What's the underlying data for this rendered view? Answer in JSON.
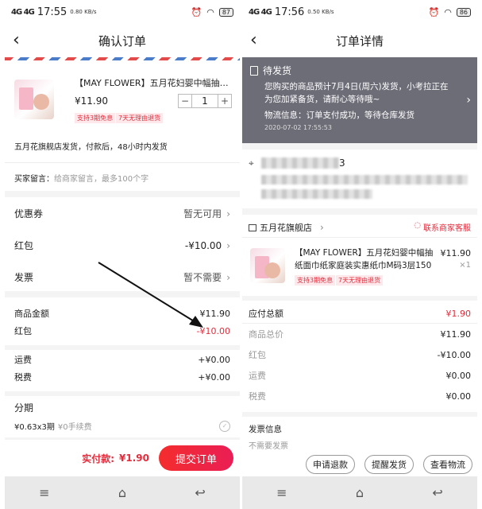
{
  "left": {
    "status": {
      "signal": "4G 4G",
      "time": "17:55",
      "speed": "0.80 KB/s",
      "battery": "87"
    },
    "title": "确认订单",
    "product": {
      "title": "【MAY FLOWER】五月花妇婴中幅抽纸面…",
      "price": "¥11.90",
      "quantity": "1",
      "tag_installment": "支持3期免息",
      "tag_return": "7天无理由退货"
    },
    "shipping_note": "五月花旗舰店发货，付款后，48小时内发货",
    "buyer_message": {
      "label": "买家留言：",
      "placeholder": "给商家留言，最多100个字"
    },
    "options": [
      {
        "label": "优惠券",
        "value": "暂无可用"
      },
      {
        "label": "红包",
        "value": "-¥10.00"
      },
      {
        "label": "发票",
        "value": "暂不需要"
      }
    ],
    "summary": [
      {
        "label": "商品金额",
        "value": "¥11.90"
      },
      {
        "label": "红包",
        "value": "-¥10.00"
      },
      {
        "label": "运费",
        "value": "+¥0.00"
      },
      {
        "label": "税费",
        "value": "+¥0.00"
      }
    ],
    "installment": {
      "title": "分期",
      "plan": "¥0.63x3期",
      "fee": "¥0手续费"
    },
    "total": {
      "label": "实付款:",
      "value": "¥1.90"
    },
    "submit": "提交订单"
  },
  "right": {
    "status": {
      "signal": "4G 4G",
      "time": "17:56",
      "speed": "0.50 KB/s",
      "battery": "86"
    },
    "title": "订单详情",
    "order_status": {
      "title": "待发货",
      "message": "您购买的商品预计7月4日(周六)发货，小考拉正在为您加紧备货，请耐心等待哦~",
      "logistics": "物流信息：订单支付成功，等待仓库发货",
      "time": "2020-07-02 17:55:53"
    },
    "address": {
      "visible": "3"
    },
    "store": {
      "name": "五月花旗舰店",
      "service": "联系商家客服"
    },
    "product": {
      "title": "【MAY FLOWER】五月花妇婴中幅抽纸面巾纸家庭装实惠纸巾M码3层150抽…",
      "price": "¥11.90",
      "count": "×1",
      "tag_installment": "支持3期免息",
      "tag_return": "7天无理由退货"
    },
    "payable": {
      "label": "应付总额",
      "value": "¥1.90"
    },
    "details": [
      {
        "label": "商品总价",
        "value": "¥11.90"
      },
      {
        "label": "红包",
        "value": "-¥10.00"
      },
      {
        "label": "运费",
        "value": "¥0.00"
      },
      {
        "label": "税费",
        "value": "¥0.00"
      }
    ],
    "invoice": {
      "title": "发票信息",
      "value": "不需要发票"
    },
    "actions": [
      "申请退款",
      "提醒发货",
      "查看物流"
    ]
  },
  "colors": {
    "accent": "#e02e3e",
    "status_panel": "#6d6d78"
  }
}
